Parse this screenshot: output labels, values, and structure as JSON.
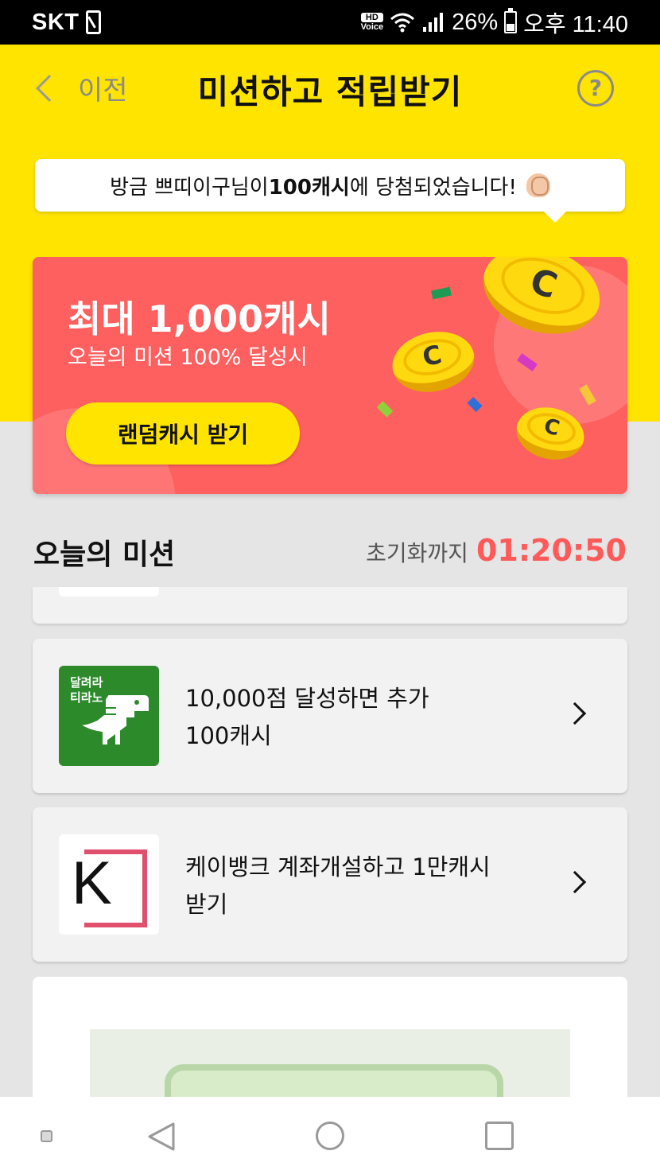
{
  "status_bar": {
    "carrier": "SKT",
    "hd_top": "HD",
    "hd_bottom": "Voice",
    "battery": "26%",
    "time": "오후 11:40"
  },
  "header": {
    "back_label": "이전",
    "title": "미션하고 적립받기",
    "help": "?"
  },
  "toast": {
    "prefix": "방금 쁘띠이구님이 ",
    "amount": "100캐시",
    "suffix": "에 당첨되었습니다!"
  },
  "promo": {
    "title": "최대 1,000캐시",
    "subtitle": "오늘의 미션 100% 달성시",
    "button": "랜덤캐시 받기",
    "bg_color": "#fe5f5f",
    "button_color": "#ffe400"
  },
  "missions_section": {
    "title": "오늘의 미션",
    "reset_label": "초기화까지",
    "reset_time": "01:20:50",
    "accent": "#ff5959"
  },
  "missions": [
    {
      "thumb_label_1": "달려라",
      "thumb_label_2": "티라노",
      "text_line_1": "10,000점 달성하면 추가",
      "text_line_2": "100캐시"
    },
    {
      "thumb_label": "K",
      "text_line_1": "케이뱅크 계좌개설하고 1만캐시",
      "text_line_2": "받기"
    }
  ]
}
